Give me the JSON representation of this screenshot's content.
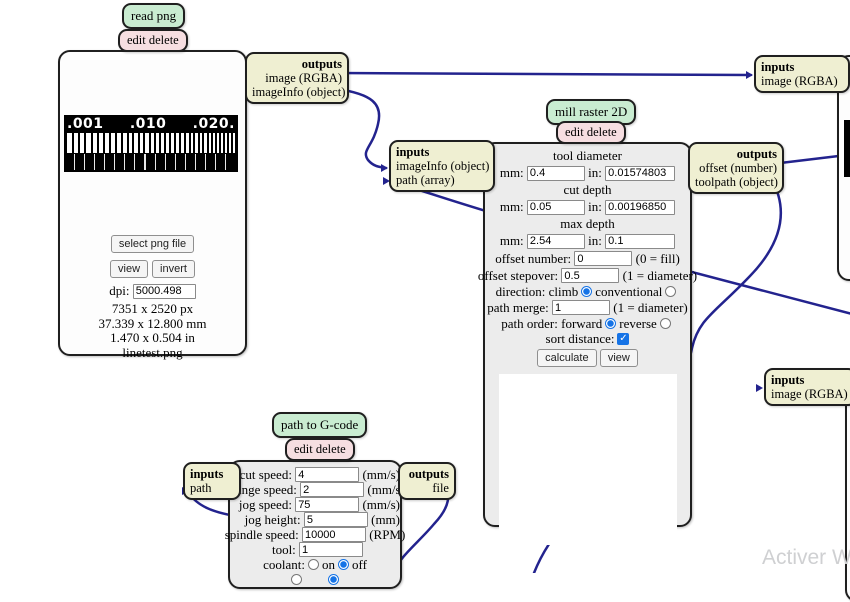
{
  "canvas": {
    "background": "#ffffff",
    "wire_color": "#23238e"
  },
  "glyphs": {
    "check": "✓"
  },
  "watermark": "Activer W",
  "read_png": {
    "title": "read png",
    "edit": "edit delete",
    "outputs_title": "outputs",
    "outputs": [
      "image (RGBA)",
      "imageInfo (object)"
    ],
    "preview_labels": [
      ".001",
      ".010",
      ".020."
    ],
    "select_button": "select png file",
    "view_button": "view",
    "invert_button": "invert",
    "dpi_label": "dpi:",
    "dpi_value": "5000.498",
    "info": [
      "7351 x 2520 px",
      "37.339 x 12.800 mm",
      "1.470 x 0.504 in",
      "linetest.png"
    ]
  },
  "mill": {
    "title": "mill raster 2D",
    "edit": "edit delete",
    "inputs_title": "inputs",
    "inputs": [
      "imageInfo (object)",
      "path (array)"
    ],
    "outputs_title": "outputs",
    "outputs": [
      "offset (number)",
      "toolpath (object)"
    ],
    "mm_label": "mm:",
    "in_label": "in:",
    "tool_diameter": {
      "heading": "tool diameter",
      "mm": "0.4",
      "in": "0.01574803"
    },
    "cut_depth": {
      "heading": "cut depth",
      "mm": "0.05",
      "in": "0.00196850"
    },
    "max_depth": {
      "heading": "max depth",
      "mm": "2.54",
      "in": "0.1"
    },
    "offset_number": {
      "label": "offset number:",
      "value": "0",
      "hint": "(0 = fill)"
    },
    "offset_stepover": {
      "label": "offset stepover:",
      "value": "0.5",
      "hint": "(1 = diameter)"
    },
    "direction": {
      "label": "direction:",
      "option_a": "climb",
      "option_b": "conventional",
      "selected": "climb"
    },
    "path_merge": {
      "label": "path merge:",
      "value": "1",
      "hint": "(1 = diameter)"
    },
    "path_order": {
      "label": "path order:",
      "option_a": "forward",
      "option_b": "reverse",
      "selected": "forward"
    },
    "sort_distance": {
      "label": "sort distance:",
      "checked": true
    },
    "calculate_button": "calculate",
    "view_button": "view"
  },
  "gcode": {
    "title": "path to G-code",
    "edit": "edit delete",
    "inputs_title": "inputs",
    "inputs": [
      "path"
    ],
    "outputs_title": "outputs",
    "outputs": [
      "file"
    ],
    "rows": [
      {
        "label": "cut speed:",
        "value": "4",
        "unit": "(mm/s)"
      },
      {
        "label": "plunge speed:",
        "value": "2",
        "unit": "(mm/s)"
      },
      {
        "label": "jog speed:",
        "value": "75",
        "unit": "(mm/s)"
      },
      {
        "label": "jog height:",
        "value": "5",
        "unit": "(mm)"
      },
      {
        "label": "spindle speed:",
        "value": "10000",
        "unit": "(RPM)"
      },
      {
        "label": "tool:",
        "value": "1",
        "unit": ""
      }
    ],
    "coolant": {
      "label": "coolant:",
      "option_a": "on",
      "option_b": "off",
      "selected": "off"
    }
  },
  "top_right_module": {
    "inputs_title": "inputs",
    "inputs": [
      "image (RGBA)"
    ]
  },
  "mid_right_module": {
    "inputs_title": "inputs",
    "inputs": [
      "image (RGBA)"
    ]
  }
}
